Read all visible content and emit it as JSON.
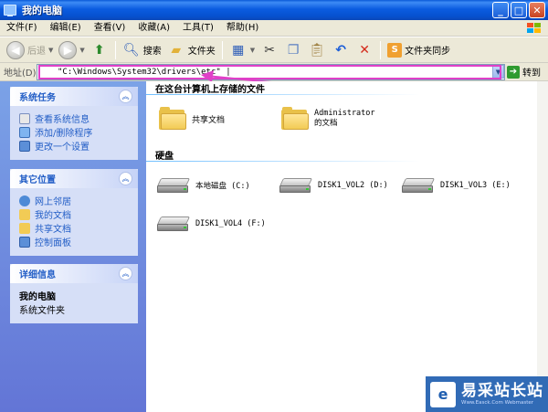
{
  "window": {
    "title": "我的电脑"
  },
  "menu": [
    "文件(F)",
    "编辑(E)",
    "查看(V)",
    "收藏(A)",
    "工具(T)",
    "帮助(H)"
  ],
  "toolbar": {
    "back_label": "后退",
    "search_label": "搜索",
    "folders_label": "文件夹",
    "sync_label": "文件夹同步"
  },
  "address": {
    "label": "地址(D)",
    "value": "\"C:\\Windows\\System32\\drivers\\etc\" |",
    "go_label": "转到"
  },
  "left_panel": {
    "system_tasks": {
      "title": "系统任务",
      "items": [
        "查看系统信息",
        "添加/删除程序",
        "更改一个设置"
      ]
    },
    "other_places": {
      "title": "其它位置",
      "items": [
        "网上邻居",
        "我的文档",
        "共享文档",
        "控制面板"
      ]
    },
    "details": {
      "title": "详细信息",
      "name": "我的电脑",
      "type": "系统文件夹"
    }
  },
  "main": {
    "group_files": "在这台计算机上存储的文件",
    "folders": [
      "共享文档",
      "Administrator 的文档"
    ],
    "group_disks": "硬盘",
    "drives": [
      "本地磁盘 (C:)",
      "DISK1_VOL2 (D:)",
      "DISK1_VOL3 (E:)",
      "DISK1_VOL4 (F:)"
    ]
  },
  "watermark": {
    "logo": "e",
    "name": "易采站长站",
    "url": "Www.Easck.Com Webmaster"
  },
  "colors": {
    "titlebar": "#0b5ce0",
    "taskpane": "#6375d6",
    "link": "#215dc6",
    "annotation": "#e040c8"
  }
}
